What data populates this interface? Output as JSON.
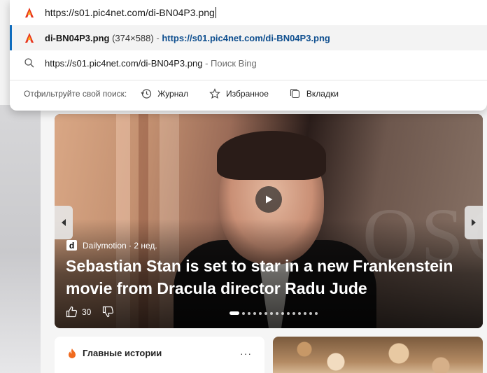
{
  "address_bar": {
    "url": "https://s01.pic4net.com/di-BN04P3.png"
  },
  "suggestions": [
    {
      "name": "di-BN04P3.png",
      "dims": "(374×588)",
      "separator": "-",
      "link": "https://s01.pic4net.com/di-BN04P3.png"
    },
    {
      "text": "https://s01.pic4net.com/di-BN04P3.png",
      "suffix": "- Поиск Bing"
    }
  ],
  "filter": {
    "label": "Отфильтруйте свой поиск:",
    "options": [
      "Журнал",
      "Избранное",
      "Вкладки"
    ]
  },
  "hero": {
    "source_logo": "d",
    "source": "Dailymotion · 2 нед.",
    "headline": "Sebastian Stan is set to star in a new Frankenstein movie from Dracula director Radu Jude",
    "likes": "30",
    "watermark": "OSC",
    "slide_count": 15,
    "active_slide": 0
  },
  "top_stories": {
    "title": "Главные истории",
    "more": "···"
  },
  "colors": {
    "accent": "#0f6cbd",
    "link": "#0f4f8f"
  },
  "icons": [
    "pdf-reader-icon",
    "search-icon",
    "history-icon",
    "star-icon",
    "tabs-icon",
    "play-icon",
    "chevron-left-icon",
    "chevron-right-icon",
    "thumbs-up-icon",
    "thumbs-down-icon",
    "flame-icon"
  ]
}
